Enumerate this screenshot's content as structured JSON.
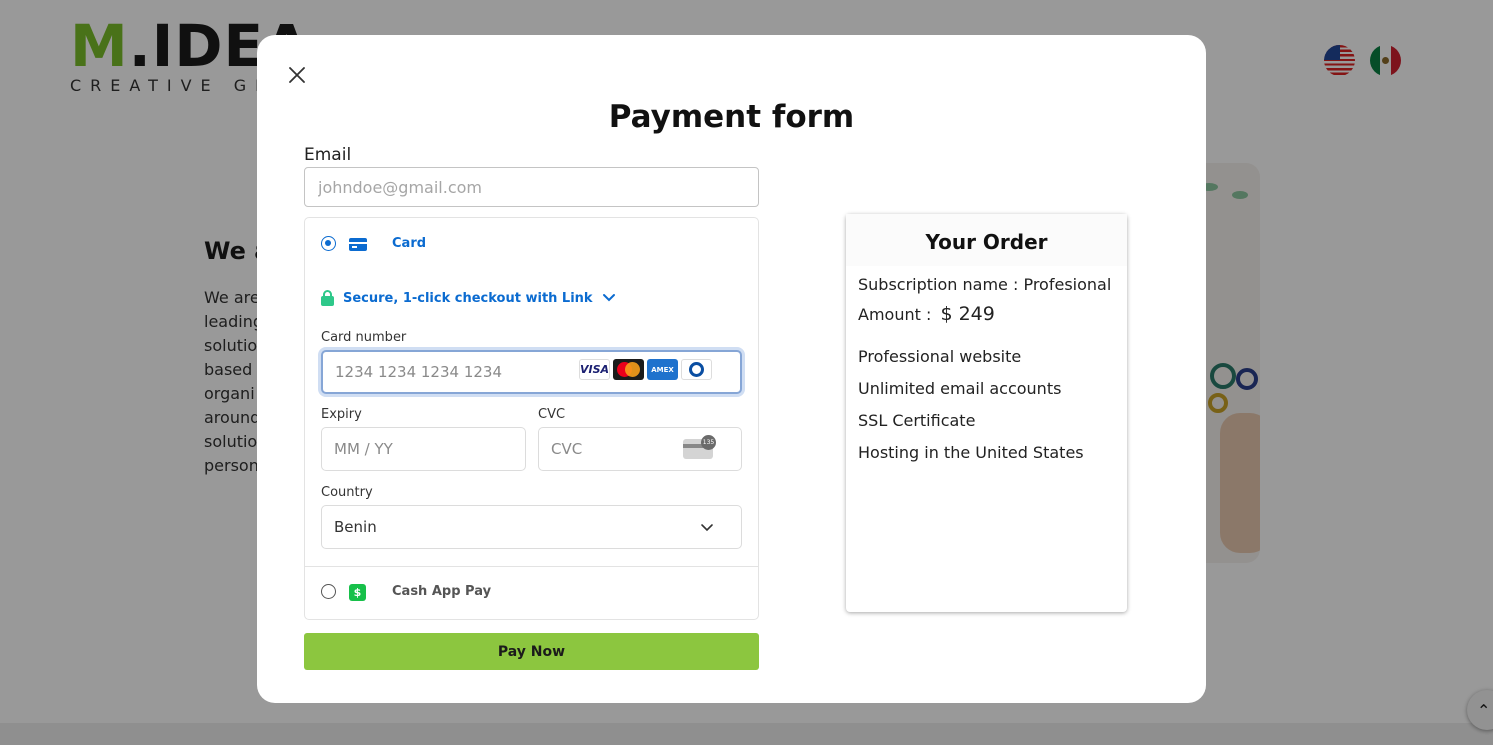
{
  "background": {
    "logo": {
      "main_m": "M",
      "main_rest": ".IDEA",
      "sub": "CREATIVE GROUP"
    },
    "heading": "We are",
    "paragraph_lines": [
      "We are",
      "leading",
      "solution",
      "based",
      "organi",
      "around",
      "solution",
      "person"
    ],
    "flags": [
      "us-flag-icon",
      "mx-flag-icon"
    ]
  },
  "modal": {
    "title": "Payment form",
    "email": {
      "label": "Email",
      "placeholder": "johndoe@gmail.com",
      "value": ""
    },
    "payment_methods": [
      {
        "label": "Card",
        "selected": true,
        "icon": "card-icon"
      },
      {
        "label": "Cash App Pay",
        "selected": false,
        "icon": "cash-app-icon"
      }
    ],
    "link_checkout": "Secure, 1-click checkout with Link",
    "card_number": {
      "label": "Card number",
      "placeholder": "1234 1234 1234 1234"
    },
    "card_brands": [
      "VISA",
      "Mastercard",
      "AMEX",
      "Diners"
    ],
    "expiry": {
      "label": "Expiry",
      "placeholder": "MM / YY"
    },
    "cvc": {
      "label": "CVC",
      "placeholder": "CVC",
      "icon_text": "135"
    },
    "country": {
      "label": "Country",
      "value": "Benin"
    },
    "pay_button": "Pay Now"
  },
  "order": {
    "title": "Your Order",
    "subscription_label": "Subscription name :",
    "subscription_value": "Profesional",
    "amount_label": "Amount :",
    "amount_value": "$ 249",
    "features": [
      "Professional website",
      "Unlimited email accounts",
      "SSL Certificate",
      "Hosting in the United States"
    ]
  },
  "colors": {
    "accent_blue": "#0b6bd0",
    "pay_button": "#8cc63f",
    "logo_green": "#7bbf2a",
    "link_green": "#2ec88a",
    "cash_app_green": "#17c04a"
  }
}
